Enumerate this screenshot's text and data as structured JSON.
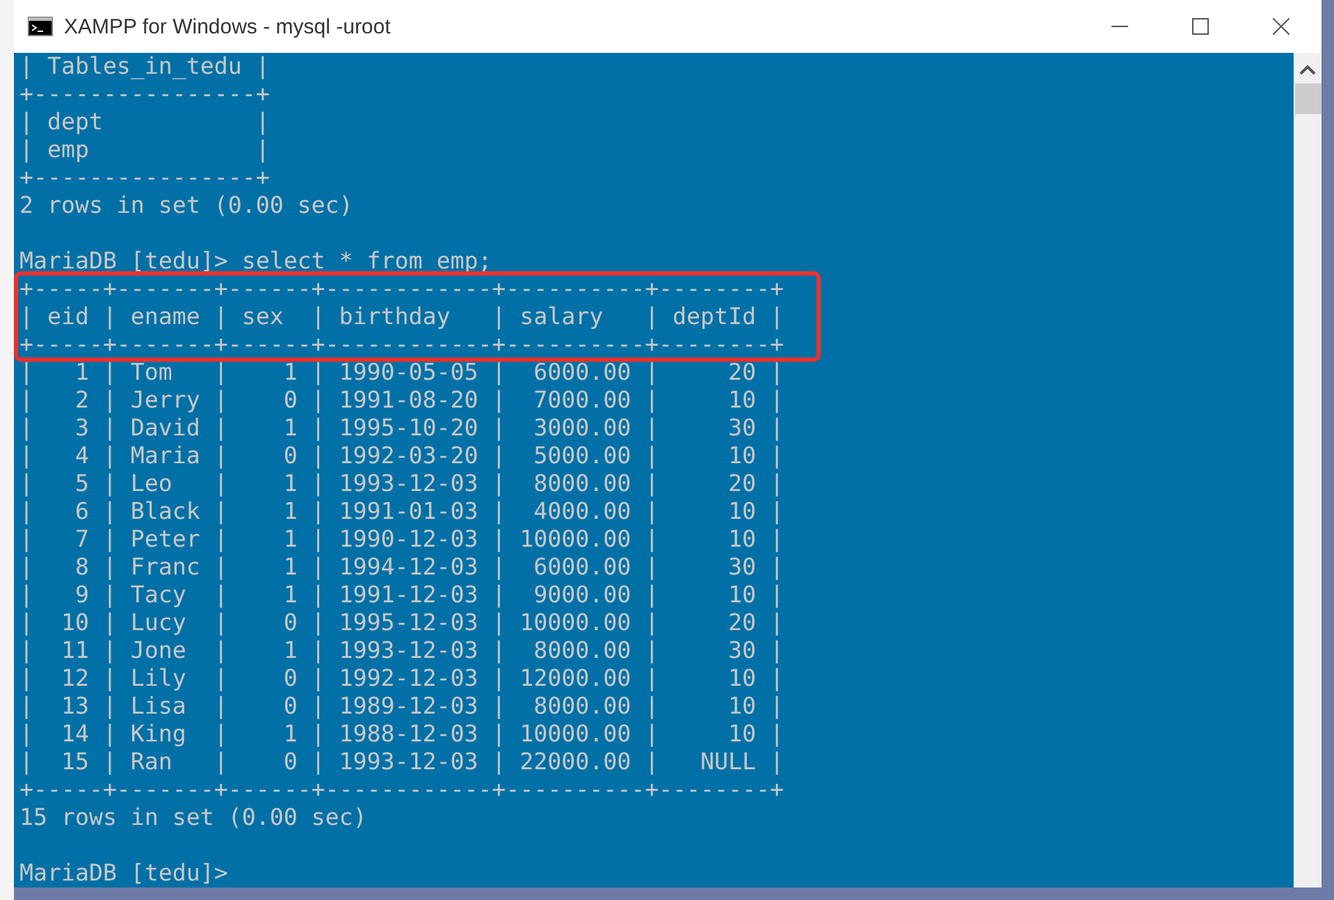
{
  "window": {
    "title": "XAMPP for Windows - mysql  -uroot"
  },
  "console": {
    "lines": [
      {
        "kind": "output",
        "text": "| Tables_in_tedu |"
      },
      {
        "kind": "output",
        "text": "+----------------+"
      },
      {
        "kind": "output",
        "text": "| dept           |"
      },
      {
        "kind": "output",
        "text": "| emp            |"
      },
      {
        "kind": "output",
        "text": "+----------------+"
      },
      {
        "kind": "output",
        "text": "2 rows in set (0.00 sec)"
      },
      {
        "kind": "prompt",
        "text": "MariaDB [tedu]> select * from emp;"
      },
      {
        "kind": "output",
        "text": "+-----+-------+------+------------+----------+--------+"
      },
      {
        "kind": "output",
        "text": "| eid | ename | sex  | birthday   | salary   | deptId |"
      },
      {
        "kind": "output",
        "text": "+-----+-------+------+------------+----------+--------+"
      },
      {
        "kind": "output",
        "text": "|   1 | Tom   |    1 | 1990-05-05 |  6000.00 |     20 |"
      },
      {
        "kind": "output",
        "text": "|   2 | Jerry |    0 | 1991-08-20 |  7000.00 |     10 |"
      },
      {
        "kind": "output",
        "text": "|   3 | David |    1 | 1995-10-20 |  3000.00 |     30 |"
      },
      {
        "kind": "output",
        "text": "|   4 | Maria |    0 | 1992-03-20 |  5000.00 |     10 |"
      },
      {
        "kind": "output",
        "text": "|   5 | Leo   |    1 | 1993-12-03 |  8000.00 |     20 |"
      },
      {
        "kind": "output",
        "text": "|   6 | Black |    1 | 1991-01-03 |  4000.00 |     10 |"
      },
      {
        "kind": "output",
        "text": "|   7 | Peter |    1 | 1990-12-03 | 10000.00 |     10 |"
      },
      {
        "kind": "output",
        "text": "|   8 | Franc |    1 | 1994-12-03 |  6000.00 |     30 |"
      },
      {
        "kind": "output",
        "text": "|   9 | Tacy  |    1 | 1991-12-03 |  9000.00 |     10 |"
      },
      {
        "kind": "output",
        "text": "|  10 | Lucy  |    0 | 1995-12-03 | 10000.00 |     20 |"
      },
      {
        "kind": "output",
        "text": "|  11 | Jone  |    1 | 1993-12-03 |  8000.00 |     30 |"
      },
      {
        "kind": "output",
        "text": "|  12 | Lily  |    0 | 1992-12-03 | 12000.00 |     10 |"
      },
      {
        "kind": "output",
        "text": "|  13 | Lisa  |    0 | 1989-12-03 |  8000.00 |     10 |"
      },
      {
        "kind": "output",
        "text": "|  14 | King  |    1 | 1988-12-03 | 10000.00 |     10 |"
      },
      {
        "kind": "output",
        "text": "|  15 | Ran   |    0 | 1993-12-03 | 22000.00 |   NULL |"
      },
      {
        "kind": "output",
        "text": "+-----+-------+------+------------+----------+--------+"
      },
      {
        "kind": "output",
        "text": "15 rows in set (0.00 sec)"
      },
      {
        "kind": "prompt",
        "text": "MariaDB [tedu]>"
      }
    ]
  }
}
